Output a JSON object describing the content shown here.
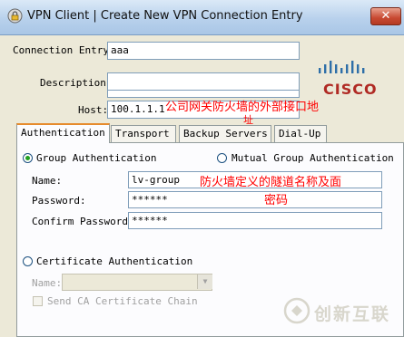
{
  "window": {
    "title": "VPN Client  |  Create New VPN Connection Entry",
    "close_symbol": "✕"
  },
  "brand": {
    "logo_text": "CISCO"
  },
  "connection": {
    "entry_label": "Connection Entry:",
    "entry_value": "aaa",
    "description_label": "Description:",
    "description_value": "",
    "host_label": "Host:",
    "host_value": "100.1.1.1"
  },
  "annotations": {
    "host_note_line1": "公司网关防火墙的外部接口地",
    "host_note_line2": "址",
    "group_note_line1": "防火墙定义的隧道名称及面",
    "group_note_line2": "密码"
  },
  "tabs": [
    {
      "label": "Authentication"
    },
    {
      "label": "Transport"
    },
    {
      "label": "Backup Servers"
    },
    {
      "label": "Dial-Up"
    }
  ],
  "auth": {
    "group_auth_label": "Group Authentication",
    "mutual_auth_label": "Mutual Group Authentication",
    "name_label": "Name:",
    "name_value": "lv-group",
    "password_label": "Password:",
    "password_value": "******",
    "confirm_label": "Confirm Password:",
    "confirm_value": "******",
    "cert_auth_label": "Certificate Authentication",
    "cert_name_label": "Name:",
    "cert_name_value": "",
    "send_ca_label": "Send CA Certificate Chain"
  },
  "watermark": {
    "text": "创新互联"
  },
  "icons": {
    "app": "vpn-lock-icon",
    "close": "close-icon",
    "logo": "cisco-bars-icon",
    "dropdown": "chevron-down-icon",
    "watermark": "chuangxin-logo-icon"
  }
}
